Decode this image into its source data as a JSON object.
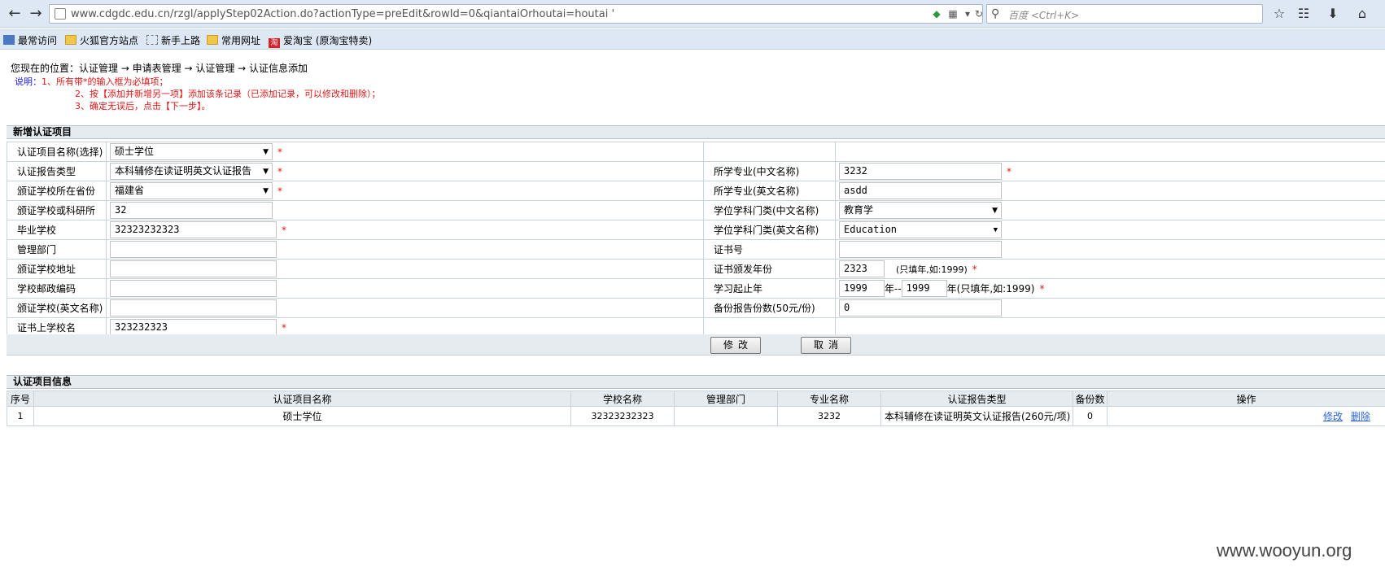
{
  "browser": {
    "url": "www.cdgdc.edu.cn/rzgl/applyStep02Action.do?actionType=preEdit&rowId=0&qiantaiOrhoutai=houtai  '",
    "search_placeholder": "百度 <Ctrl+K>",
    "bookmarks": [
      "最常访问",
      "火狐官方站点",
      "新手上路",
      "常用网址",
      "爱淘宝 (原淘宝特卖)"
    ]
  },
  "breadcrumb": "您现在的位置：认证管理 → 申请表管理 → 认证管理 → 认证信息添加",
  "notes": {
    "label": "说明：",
    "line1": "1、所有带*的输入框为必填项；",
    "line2": "2、按【添加并新增另一项】添加该条记录（已添加记录，可以修改和删除）；",
    "line3": "3、确定无误后，点击【下一步】。"
  },
  "form": {
    "title": "新增认证项目",
    "req_mark": "*",
    "left": {
      "item_name_label": "认证项目名称(选择)",
      "item_name_value": "硕士学位",
      "report_type_label": "认证报告类型",
      "report_type_value": "本科辅修在读证明英文认证报告",
      "province_label": "颁证学校所在省份",
      "province_value": "福建省",
      "institute_label": "颁证学校或科研所",
      "institute_value": "32",
      "grad_school_label": "毕业学校",
      "grad_school_value": "32323232323",
      "dept_label": "管理部门",
      "dept_value": "",
      "address_label": "颁证学校地址",
      "address_value": "",
      "postcode_label": "学校邮政编码",
      "postcode_value": "",
      "school_en_label": "颁证学校(英文名称)",
      "school_en_value": "",
      "cert_school_label": "证书上学校名",
      "cert_school_value": "323232323"
    },
    "right": {
      "major_cn_label": "所学专业(中文名称)",
      "major_cn_value": "3232",
      "major_en_label": "所学专业(英文名称)",
      "major_en_value": "asdd",
      "category_cn_label": "学位学科门类(中文名称)",
      "category_cn_value": "教育学",
      "category_en_label": "学位学科门类(英文名称)",
      "category_en_value": "Education",
      "cert_no_label": "证书号",
      "cert_no_value": "",
      "issue_year_label": "证书颁发年份",
      "issue_year_value": "2323",
      "issue_year_hint": "(只填年,如:1999)",
      "study_years_label": "学习起止年",
      "study_start": "1999",
      "study_sep": "年--",
      "study_end": "1999",
      "study_hint": "年(只填年,如:1999)",
      "copies_label": "备份报告份数(50元/份)",
      "copies_value": "0"
    },
    "buttons": {
      "modify": "修改",
      "cancel": "取消"
    }
  },
  "records": {
    "title": "认证项目信息",
    "columns": [
      "序号",
      "认证项目名称",
      "学校名称",
      "管理部门",
      "专业名称",
      "认证报告类型",
      "备份数",
      "操作"
    ],
    "rows": [
      {
        "no": "1",
        "item": "硕士学位",
        "school": "32323232323",
        "dept": "",
        "major": "3232",
        "report": "本科辅修在读证明英文认证报告(260元/项)",
        "copies": "0",
        "edit": "修改",
        "delete": "删除"
      }
    ]
  },
  "watermark": "www.wooyun.org"
}
